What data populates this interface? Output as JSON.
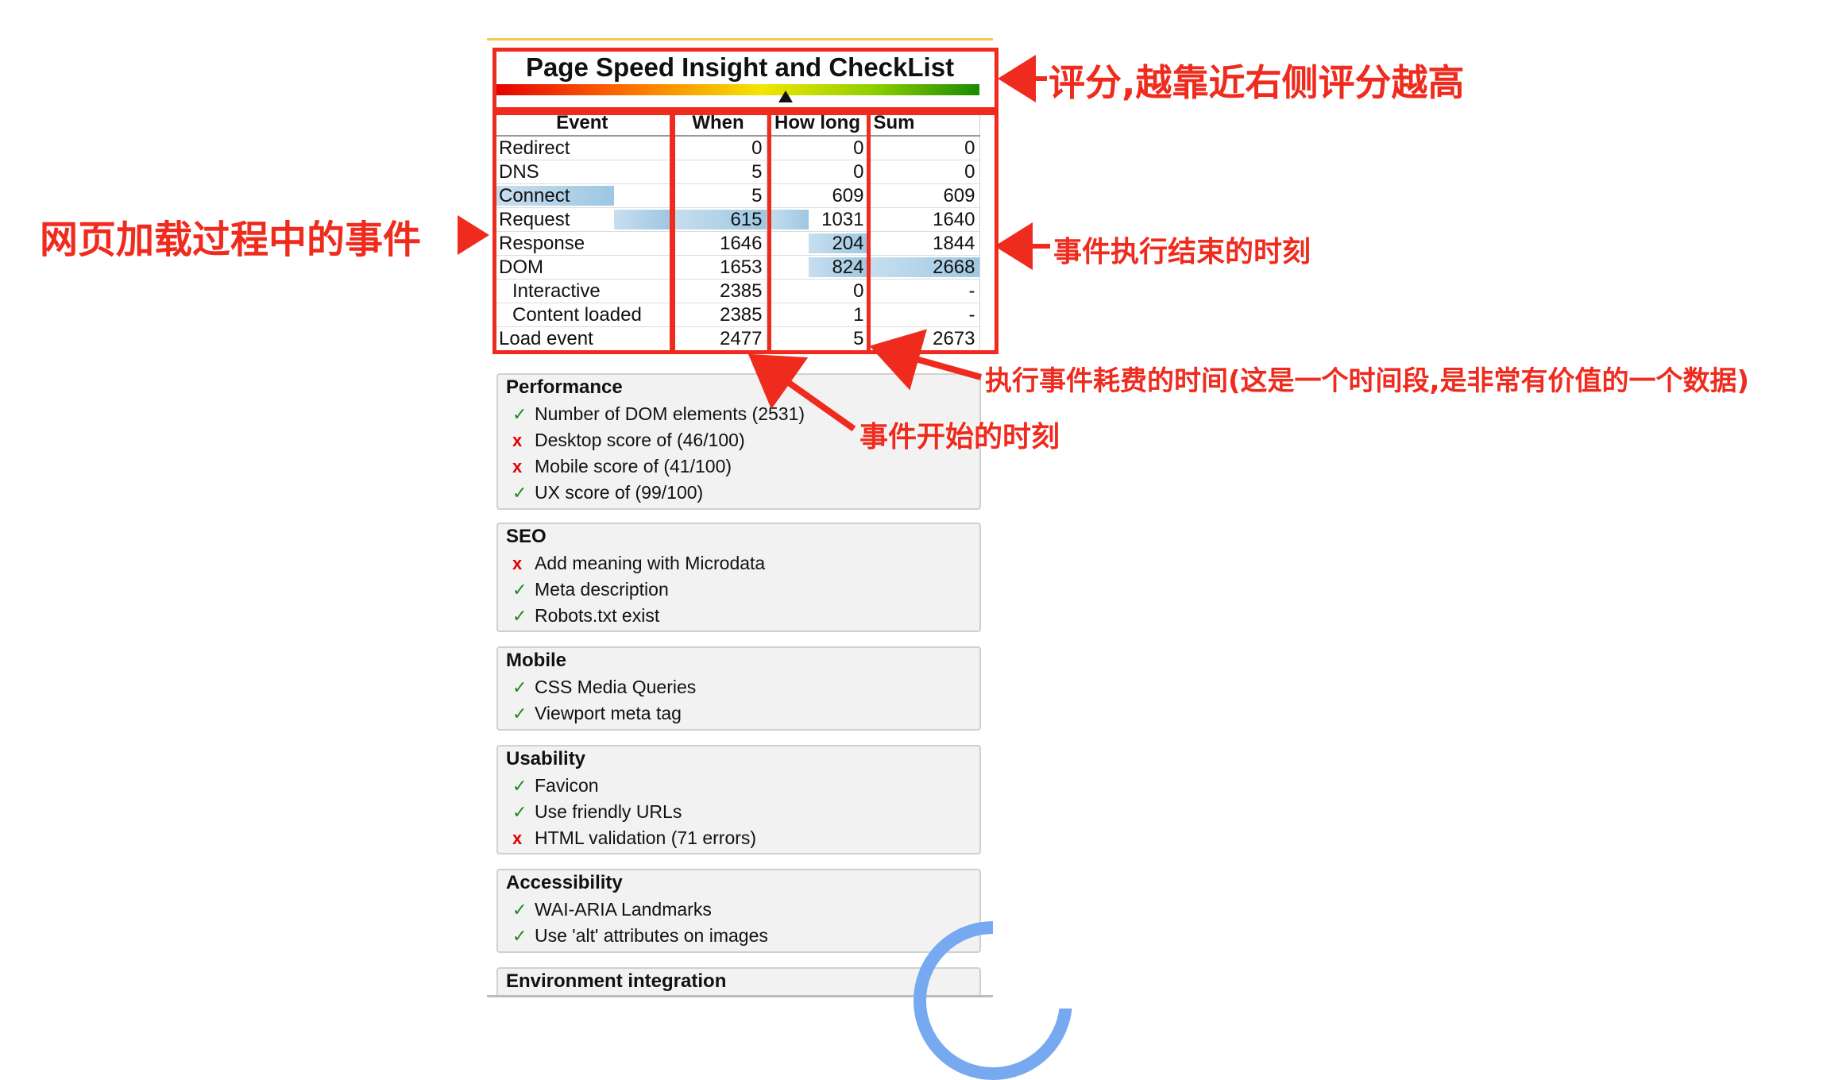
{
  "panel": {
    "title": "Page Speed Insight and CheckList",
    "score_marker": "▲"
  },
  "timing": {
    "headers": [
      "Event",
      "When",
      "How long",
      "Sum"
    ],
    "rows": [
      {
        "event": "Redirect",
        "when": "0",
        "how_long": "0",
        "sum": "0",
        "indent": false
      },
      {
        "event": "DNS",
        "when": "5",
        "how_long": "0",
        "sum": "0",
        "indent": false
      },
      {
        "event": "Connect",
        "when": "5",
        "how_long": "609",
        "sum": "609",
        "indent": false
      },
      {
        "event": "Request",
        "when": "615",
        "how_long": "1031",
        "sum": "1640",
        "indent": false
      },
      {
        "event": "Response",
        "when": "1646",
        "how_long": "204",
        "sum": "1844",
        "indent": false
      },
      {
        "event": "DOM",
        "when": "1653",
        "how_long": "824",
        "sum": "2668",
        "indent": false
      },
      {
        "event": "Interactive",
        "when": "2385",
        "how_long": "0",
        "sum": "-",
        "indent": true
      },
      {
        "event": "Content loaded",
        "when": "2385",
        "how_long": "1",
        "sum": "-",
        "indent": true
      },
      {
        "event": "Load event",
        "when": "2477",
        "how_long": "5",
        "sum": "2673",
        "indent": false
      }
    ]
  },
  "sections": [
    {
      "title": "Performance",
      "items": [
        {
          "status": "ok",
          "text": "Number of DOM elements (2531)"
        },
        {
          "status": "bad",
          "text": "Desktop score of (46/100)"
        },
        {
          "status": "bad",
          "text": "Mobile score of (41/100)"
        },
        {
          "status": "ok",
          "text": "UX score of (99/100)"
        }
      ]
    },
    {
      "title": "SEO",
      "items": [
        {
          "status": "bad",
          "text": "Add meaning with Microdata"
        },
        {
          "status": "ok",
          "text": "Meta description"
        },
        {
          "status": "ok",
          "text": "Robots.txt exist"
        }
      ]
    },
    {
      "title": "Mobile",
      "items": [
        {
          "status": "ok",
          "text": "CSS Media Queries"
        },
        {
          "status": "ok",
          "text": "Viewport meta tag"
        }
      ]
    },
    {
      "title": "Usability",
      "items": [
        {
          "status": "ok",
          "text": "Favicon"
        },
        {
          "status": "ok",
          "text": "Use friendly URLs"
        },
        {
          "status": "bad",
          "text": "HTML validation (71 errors)"
        }
      ]
    },
    {
      "title": "Accessibility",
      "items": [
        {
          "status": "ok",
          "text": "WAI-ARIA Landmarks"
        },
        {
          "status": "ok",
          "text": "Use 'alt' attributes on images"
        }
      ]
    },
    {
      "title": "Environment integration",
      "items": []
    }
  ],
  "icons": {
    "ok": "✓",
    "bad": "x"
  },
  "colors": {
    "accent_red": "#ef2b1e",
    "ok_green": "#1a8c1a",
    "bad_red": "#e00000",
    "bar_blue": "#9ec7e2"
  },
  "annotations": {
    "score": "评分,越靠近右侧评分越高",
    "events": "网页加载过程中的事件",
    "end_time": "事件执行结束的时刻",
    "duration": "执行事件耗费的时间(这是一个时间段,是非常有价值的一个数据)",
    "start_time": "事件开始的时刻"
  }
}
